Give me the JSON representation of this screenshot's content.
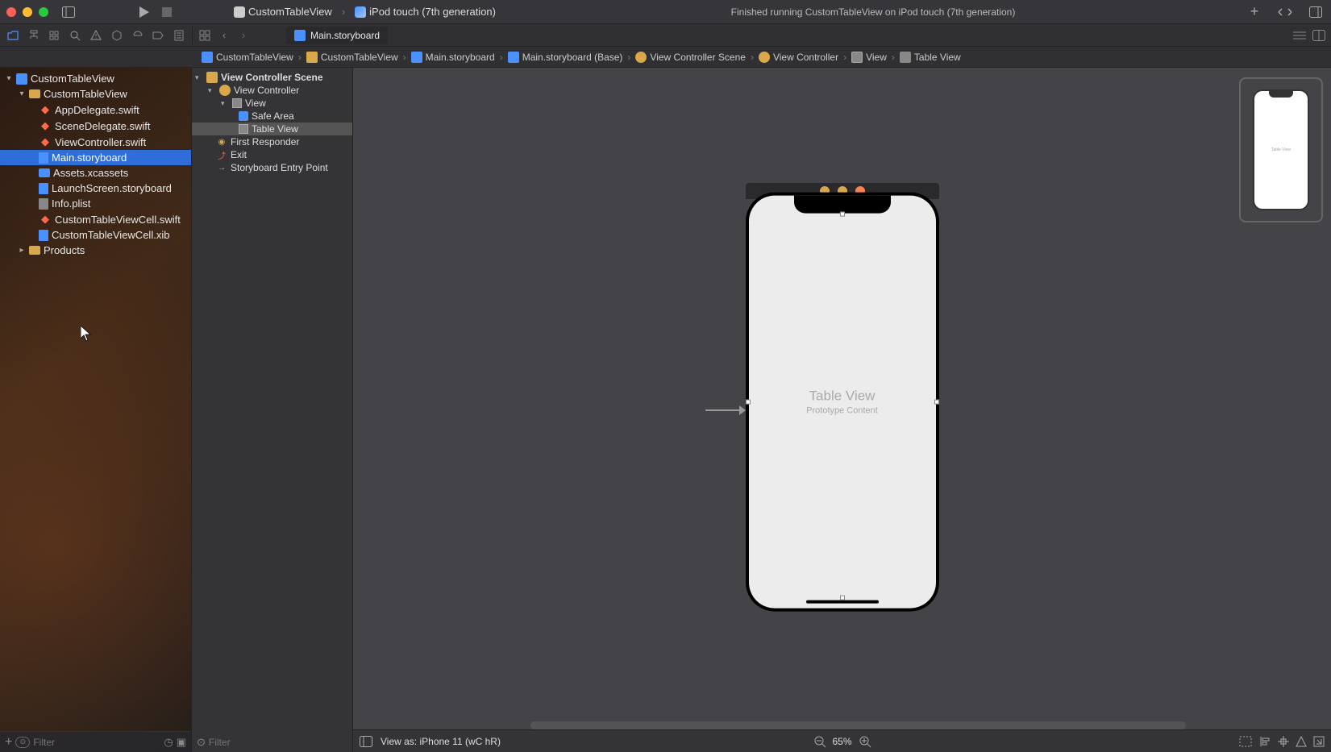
{
  "titlebar": {
    "scheme_project": "CustomTableView",
    "scheme_device": "iPod touch (7th generation)",
    "status": "Finished running CustomTableView on iPod touch (7th generation)"
  },
  "tab": {
    "label": "Main.storyboard"
  },
  "jump": [
    "CustomTableView",
    "CustomTableView",
    "Main.storyboard",
    "Main.storyboard (Base)",
    "View Controller Scene",
    "View Controller",
    "View",
    "Table View"
  ],
  "navigator": {
    "project": "CustomTableView",
    "group": "CustomTableView",
    "files": [
      "AppDelegate.swift",
      "SceneDelegate.swift",
      "ViewController.swift",
      "Main.storyboard",
      "Assets.xcassets",
      "LaunchScreen.storyboard",
      "Info.plist",
      "CustomTableViewCell.swift",
      "CustomTableViewCell.xib"
    ],
    "products": "Products",
    "filter_placeholder": "Filter"
  },
  "outline": {
    "scene": "View Controller Scene",
    "vc": "View Controller",
    "view": "View",
    "safe": "Safe Area",
    "table": "Table View",
    "responder": "First Responder",
    "exit": "Exit",
    "entry": "Storyboard Entry Point",
    "filter_placeholder": "Filter"
  },
  "canvas": {
    "table_view": "Table View",
    "prototype": "Prototype Content",
    "view_as": "View as: iPhone 11 (wC hR)",
    "zoom": "65%"
  }
}
